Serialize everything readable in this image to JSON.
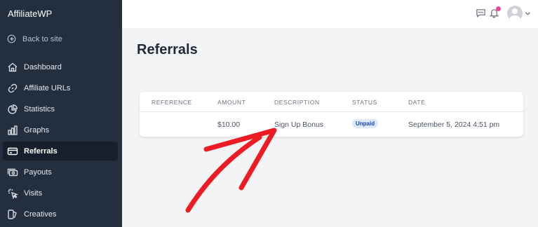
{
  "app": {
    "brand": "AffiliateWP",
    "back_label": "Back to site"
  },
  "sidebar": {
    "items": [
      {
        "label": "Dashboard",
        "icon": "home-icon"
      },
      {
        "label": "Affiliate URLs",
        "icon": "link-icon"
      },
      {
        "label": "Statistics",
        "icon": "pie-chart-icon"
      },
      {
        "label": "Graphs",
        "icon": "bar-chart-icon"
      },
      {
        "label": "Referrals",
        "icon": "credit-card-icon",
        "active": true
      },
      {
        "label": "Payouts",
        "icon": "cash-icon"
      },
      {
        "label": "Visits",
        "icon": "cursor-click-icon"
      },
      {
        "label": "Creatives",
        "icon": "creatives-icon"
      }
    ]
  },
  "topbar": {
    "icons": [
      "chat-icon",
      "bell-icon",
      "avatar",
      "chevron-down-icon"
    ],
    "notification_color": "#ec4899"
  },
  "page": {
    "title": "Referrals"
  },
  "table": {
    "headers": [
      "REFERENCE",
      "AMOUNT",
      "DESCRIPTION",
      "STATUS",
      "DATE"
    ],
    "rows": [
      {
        "reference": "",
        "amount": "$10.00",
        "description": "Sign Up Bonus",
        "status": "Unpaid",
        "date": "September 5, 2024 4:51 pm"
      }
    ]
  },
  "colors": {
    "sidebar_bg": "#232f3e",
    "active_bg": "#161f2b",
    "badge_bg": "#dbeafe",
    "badge_text": "#1e40af",
    "arrow": "#ec1c24"
  }
}
